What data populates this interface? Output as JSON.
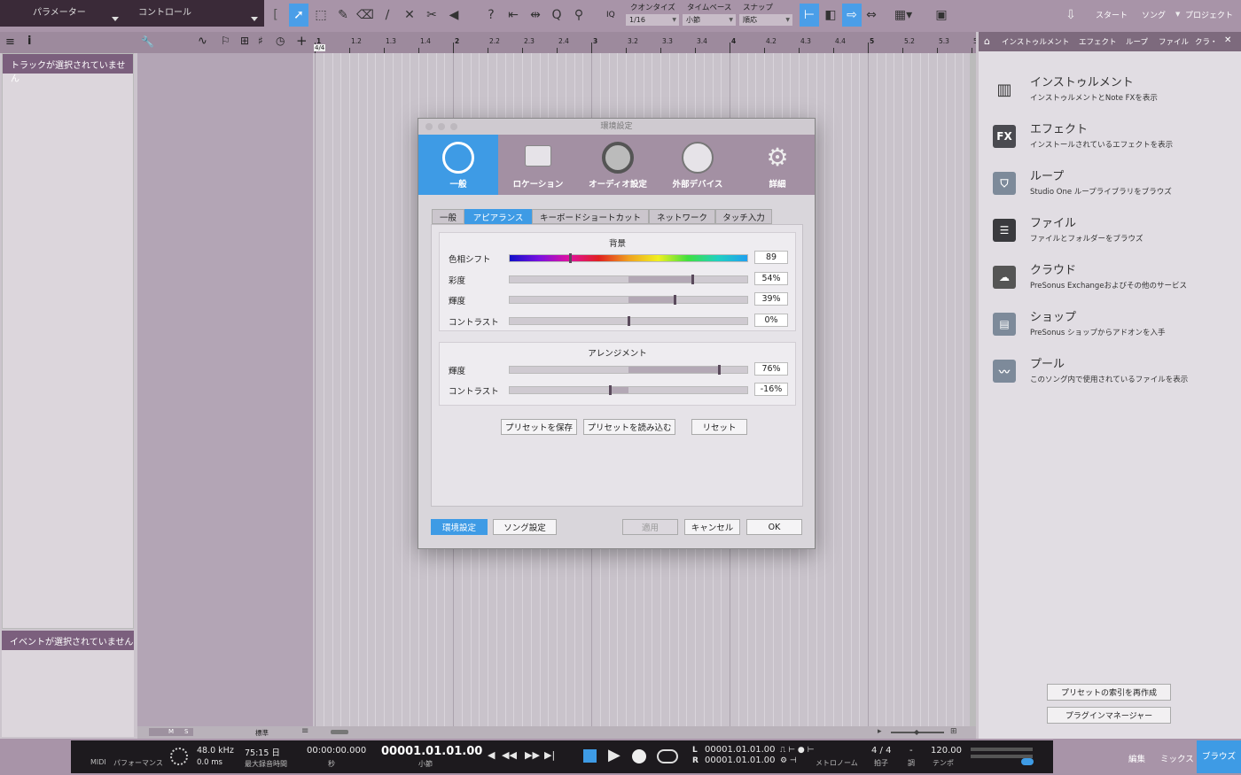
{
  "topbar": {
    "parameters_label": "パラメーター",
    "control_label": "コントロール",
    "quantize_label": "クオンタイズ",
    "quantize_value": "1/16",
    "timebase_label": "タイムベース",
    "timebase_value": "小節",
    "snap_label": "スナップ",
    "snap_value": "順応",
    "iq_label": "IQ",
    "nav": {
      "start": "スタート",
      "song": "ソング",
      "project": "プロジェクト"
    }
  },
  "inspector": {
    "no_track": "トラックが選択されていません",
    "no_event": "イベントが選択されていません"
  },
  "ruler": {
    "ticks": [
      "1",
      "1.2",
      "1.3",
      "1.4",
      "2",
      "2.2",
      "2.3",
      "2.4",
      "3",
      "3.2",
      "3.3",
      "3.4",
      "4",
      "4.2",
      "4.3",
      "4.4",
      "5",
      "5.2",
      "5.3",
      "5"
    ],
    "time_sig": "4/4"
  },
  "tracklist_footer": {
    "m": "M",
    "s": "S",
    "view": "標準"
  },
  "browser": {
    "tabs": [
      "インストゥルメント",
      "エフェクト",
      "ループ",
      "ファイル",
      "クラ・"
    ],
    "items": [
      {
        "title": "インストゥルメント",
        "desc": "インストゥルメントとNote FXを表示",
        "icon": "piano-icon"
      },
      {
        "title": "エフェクト",
        "desc": "インストールされているエフェクトを表示",
        "icon": "fx-icon"
      },
      {
        "title": "ループ",
        "desc": "Studio One ループライブラリをブラウズ",
        "icon": "loop-icon"
      },
      {
        "title": "ファイル",
        "desc": "ファイルとフォルダーをブラウズ",
        "icon": "file-icon"
      },
      {
        "title": "クラウド",
        "desc": "PreSonus Exchangeおよびその他のサービス",
        "icon": "cloud-icon"
      },
      {
        "title": "ショップ",
        "desc": "PreSonus ショップからアドオンを入手",
        "icon": "shop-icon"
      },
      {
        "title": "プール",
        "desc": "このソング内で使用されているファイルを表示",
        "icon": "pool-icon"
      }
    ],
    "fx_glyph": "FX",
    "reindex_presets": "プリセットの索引を再作成",
    "plugin_manager": "プラグインマネージャー"
  },
  "transport": {
    "midi": "MIDI",
    "performance": "パフォーマンス",
    "sample_rate": "48.0 kHz",
    "latency": "0.0 ms",
    "record_time": "75:15 日",
    "record_time_label": "最大録音時間",
    "time": "00:00:00.000",
    "time_unit": "秒",
    "position": "00001.01.01.00",
    "position_unit": "小節",
    "loop_l": "00001.01.01.00",
    "loop_r": "00001.01.01.00",
    "l": "L",
    "r": "R",
    "metronome": "メトロノーム",
    "time_sig": "4 / 4",
    "time_sig_label": "拍子",
    "key": "-",
    "key_label": "調",
    "tempo": "120.00",
    "tempo_label": "テンポ",
    "views": [
      "編集",
      "ミックス",
      "ブラウズ"
    ]
  },
  "dialog": {
    "title": "環境設定",
    "categories": [
      "一般",
      "ロケーション",
      "オーディオ設定",
      "外部デバイス",
      "詳細"
    ],
    "subtabs": [
      "一般",
      "アピアランス",
      "キーボードショートカット",
      "ネットワーク",
      "タッチ入力"
    ],
    "background": {
      "header": "背景",
      "hue_label": "色相シフト",
      "hue_value": "89",
      "saturation_label": "彩度",
      "saturation_value": "54%",
      "luminance_label": "輝度",
      "luminance_value": "39%",
      "contrast_label": "コントラスト",
      "contrast_value": "0%"
    },
    "arrangement": {
      "header": "アレンジメント",
      "luminance_label": "輝度",
      "luminance_value": "76%",
      "contrast_label": "コントラスト",
      "contrast_value": "-16%"
    },
    "levels": {
      "hue": 0.25,
      "saturation": 0.54,
      "luminance": 0.39,
      "contrast": 0.0,
      "arr_luminance": 0.76,
      "arr_contrast": -0.16
    },
    "save_preset": "プリセットを保存",
    "load_preset": "プリセットを読み込む",
    "reset": "リセット",
    "env_settings": "環境設定",
    "song_settings": "ソング設定",
    "apply": "適用",
    "cancel": "キャンセル",
    "ok": "OK"
  },
  "colors": {
    "accent": "#3e9be5",
    "purple": "#7b5f7d",
    "chrome": "#a894a8"
  }
}
